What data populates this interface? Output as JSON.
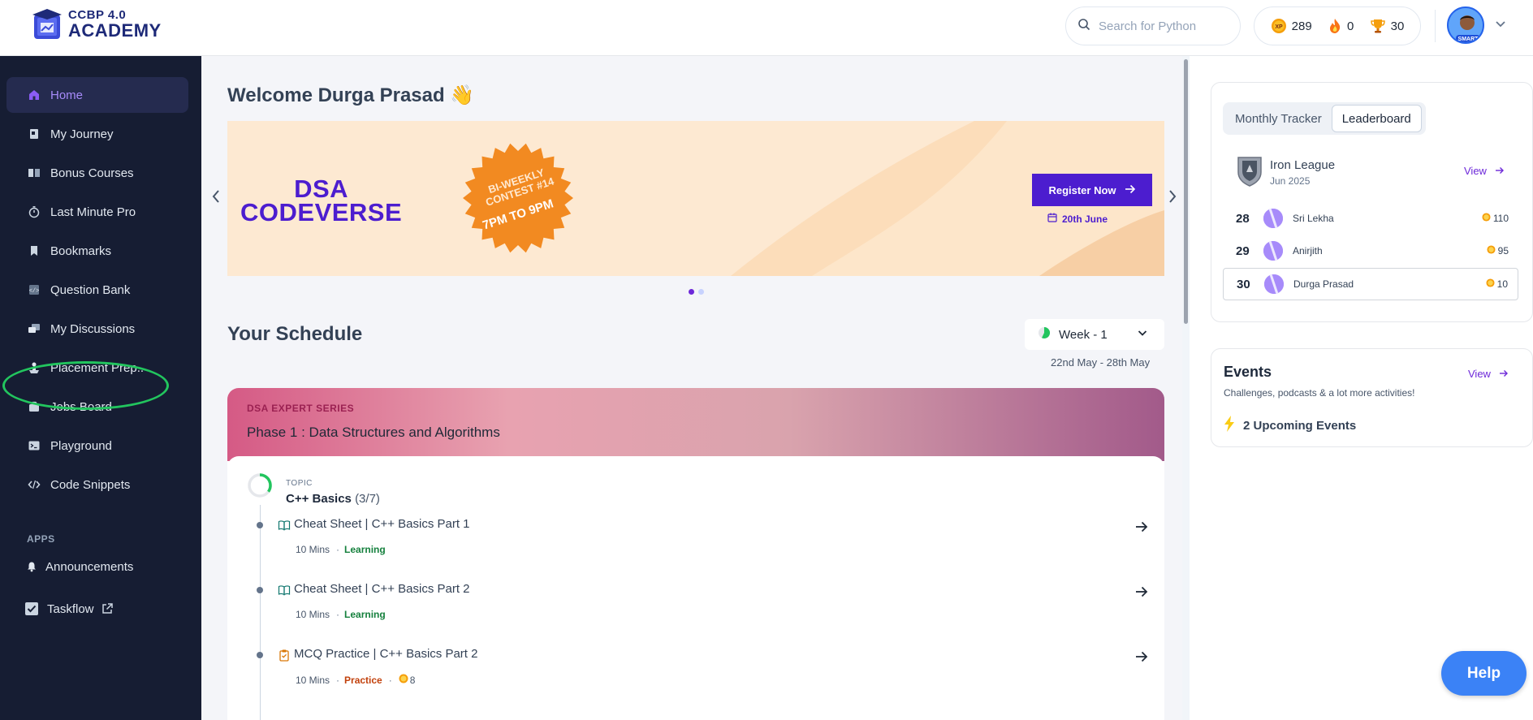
{
  "brand": {
    "line1": "CCBP 4.0",
    "line2": "ACADEMY"
  },
  "search": {
    "placeholder": "Search for Python"
  },
  "stats": {
    "xp": "289",
    "streak": "0",
    "trophies": "30",
    "xp_icon_label": "XP"
  },
  "profile": {
    "badge": "SMART"
  },
  "sidebar": {
    "items": [
      {
        "label": "Home",
        "icon": "home-icon"
      },
      {
        "label": "My Journey",
        "icon": "journey-icon"
      },
      {
        "label": "Bonus Courses",
        "icon": "book-icon"
      },
      {
        "label": "Last Minute Pro",
        "icon": "stopwatch-icon"
      },
      {
        "label": "Bookmarks",
        "icon": "bookmark-icon"
      },
      {
        "label": "Question Bank",
        "icon": "question-bank-icon"
      },
      {
        "label": "My Discussions",
        "icon": "discussions-icon"
      },
      {
        "label": "Placement Prep..",
        "icon": "placement-icon"
      },
      {
        "label": "Jobs Board",
        "icon": "briefcase-icon"
      },
      {
        "label": "Playground",
        "icon": "terminal-icon"
      },
      {
        "label": "Code Snippets",
        "icon": "code-icon"
      }
    ],
    "apps_label": "APPS",
    "apps": [
      {
        "label": "Announcements",
        "icon": "bell-icon"
      },
      {
        "label": "Taskflow",
        "icon": "checkbox-icon"
      }
    ]
  },
  "main": {
    "welcome": "Welcome Durga Prasad",
    "welcome_emoji": "👋",
    "banner": {
      "title_line1": "DSA",
      "title_line2": "CODEVERSE",
      "badge_line1": "BI-WEEKLY",
      "badge_line2": "CONTEST #14",
      "badge_line3": "7PM TO 9PM",
      "cta": "Register Now",
      "date": "20th June"
    },
    "schedule": {
      "title": "Your Schedule",
      "week": "Week - 1",
      "range": "22nd May - 28th May",
      "series_tag": "DSA EXPERT SERIES",
      "series_name": "Phase 1 : Data Structures and Algorithms",
      "topic_label": "TOPIC",
      "topic_name": "C++ Basics",
      "topic_count": "(3/7)",
      "lessons": [
        {
          "title": "Cheat Sheet | C++ Basics Part 1",
          "duration": "10 Mins",
          "type": "Learning"
        },
        {
          "title": "Cheat Sheet | C++ Basics Part 2",
          "duration": "10 Mins",
          "type": "Learning"
        },
        {
          "title": "MCQ Practice | C++ Basics Part 2",
          "duration": "10 Mins",
          "type": "Practice",
          "coins": "8"
        }
      ]
    }
  },
  "leaderboard": {
    "tabs": [
      "Monthly Tracker",
      "Leaderboard"
    ],
    "league_name": "Iron League",
    "league_date": "Jun 2025",
    "view": "View",
    "rows": [
      {
        "rank": "28",
        "name": "Sri Lekha",
        "score": "110"
      },
      {
        "rank": "29",
        "name": "Anirjith",
        "score": "95"
      },
      {
        "rank": "30",
        "name": "Durga Prasad",
        "score": "10"
      }
    ]
  },
  "events": {
    "title": "Events",
    "view": "View",
    "subtitle": "Challenges, podcasts & a lot more activities!",
    "upcoming": "2 Upcoming Events"
  },
  "help": {
    "label": "Help"
  },
  "colors": {
    "accent": "#6d28d9",
    "sidebar": "#161d33",
    "brand_purple": "#4c1dcf",
    "highlight": "#22c55e"
  }
}
